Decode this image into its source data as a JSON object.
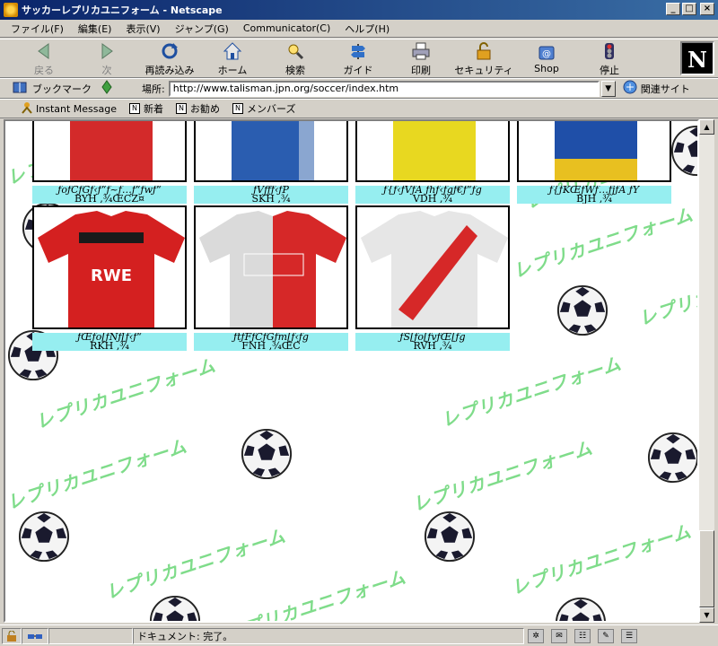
{
  "window": {
    "title": "サッカーレプリカユニフォーム - Netscape",
    "buttons": {
      "minimize": "_",
      "maximize": "□",
      "close": "×"
    }
  },
  "menu": [
    "ファイル(F)",
    "編集(E)",
    "表示(V)",
    "ジャンプ(G)",
    "Communicator(C)",
    "ヘルプ(H)"
  ],
  "nav": {
    "back": "戻る",
    "forward": "次",
    "reload": "再読み込み",
    "home": "ホーム",
    "search": "検索",
    "guide": "ガイド",
    "print": "印刷",
    "security": "セキュリティ",
    "shop": "Shop",
    "stop": "停止",
    "logo": "N"
  },
  "location": {
    "bookmark": "ブックマーク",
    "label": "場所:",
    "url": "http://www.talisman.jpn.org/soccer/index.htm",
    "related": "関連サイト"
  },
  "personal": {
    "instant_message": "Instant Message",
    "new": "新着",
    "recommend": "お勧め",
    "members": "メンバーズ"
  },
  "watermark": "レプリカユニフォーム",
  "shirts": [
    {
      "name": "ƒoƒCƒGƒ‹ƒ“ƒ~ƒ…ƒ“ƒwƒ“",
      "price": "BYH ‚¾ŒCZ¤",
      "colors": [
        "#d32a2a",
        "#b01818"
      ]
    },
    {
      "name": "ƒVƒƒƒ‹ƒP",
      "price": "SKH ‚¾",
      "colors": [
        "#2a5db0",
        "#8aa6d0"
      ]
    },
    {
      "name": "ƒ{ƒ‹ƒVƒA ƒhƒ‹ƒgƒ€ƒ“ƒg",
      "price": "VDH ‚¾",
      "colors": [
        "#e8d820",
        "#d8c810"
      ]
    },
    {
      "name": "ƒ{ƒKŒƒWƒ…ƒjƒA ƒY",
      "price": "BJH ‚¾",
      "colors": [
        "#1f4fa8",
        "#e8c020"
      ]
    },
    {
      "name": "ƒŒƒo[ƒNƒ[ƒ‹ƒ“",
      "price": "RKH ‚¾",
      "colors": [
        "#d42020",
        "#1a1a1a"
      ]
    },
    {
      "name": "ƒtƒFƒCƒGƒm[ƒ‹ƒg",
      "price": "FNH ‚¾ŒC",
      "colors": [
        "#dadada",
        "#d62828"
      ]
    },
    {
      "name": "ƒŠ[ƒo[ƒvƒŒ[ƒg",
      "price": "RVH ‚¾",
      "colors": [
        "#e6e6e6",
        "#d62828"
      ]
    }
  ],
  "status": {
    "text": "ドキュメント: 完了。"
  }
}
